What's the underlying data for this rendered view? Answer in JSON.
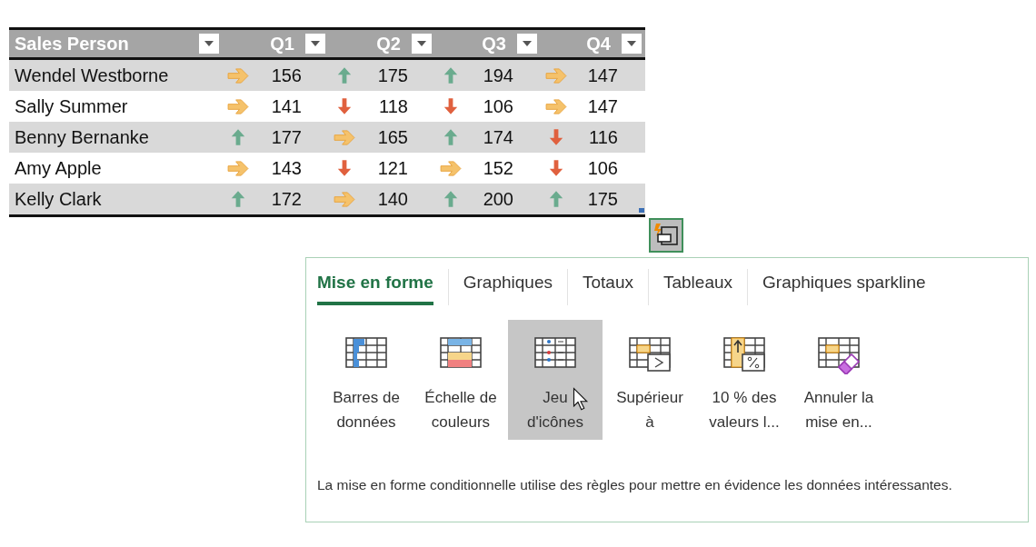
{
  "table": {
    "columns": [
      {
        "label": "Sales Person",
        "filter": true
      },
      {
        "label": "Q1",
        "filter": true
      },
      {
        "label": "Q2",
        "filter": true
      },
      {
        "label": "Q3",
        "filter": true
      },
      {
        "label": "Q4",
        "filter": true
      }
    ],
    "rows": [
      {
        "cells": [
          {
            "value": "Wendel Westborne"
          },
          {
            "value": "156",
            "kind": "flat"
          },
          {
            "value": "175",
            "kind": "up"
          },
          {
            "value": "194",
            "kind": "up"
          },
          {
            "value": "147",
            "kind": "flat"
          }
        ]
      },
      {
        "cells": [
          {
            "value": "Sally Summer"
          },
          {
            "value": "141",
            "kind": "flat"
          },
          {
            "value": "118",
            "kind": "down"
          },
          {
            "value": "106",
            "kind": "down"
          },
          {
            "value": "147",
            "kind": "flat"
          }
        ]
      },
      {
        "cells": [
          {
            "value": "Benny Bernanke"
          },
          {
            "value": "177",
            "kind": "up"
          },
          {
            "value": "165",
            "kind": "flat"
          },
          {
            "value": "174",
            "kind": "up"
          },
          {
            "value": "116",
            "kind": "down"
          }
        ]
      },
      {
        "cells": [
          {
            "value": "Amy Apple"
          },
          {
            "value": "143",
            "kind": "flat"
          },
          {
            "value": "121",
            "kind": "down"
          },
          {
            "value": "152",
            "kind": "flat"
          },
          {
            "value": "106",
            "kind": "down"
          }
        ]
      },
      {
        "cells": [
          {
            "value": "Kelly Clark"
          },
          {
            "value": "172",
            "kind": "up"
          },
          {
            "value": "140",
            "kind": "flat"
          },
          {
            "value": "200",
            "kind": "up"
          },
          {
            "value": "175",
            "kind": "up"
          }
        ]
      }
    ]
  },
  "quick_analysis": {
    "tabs": [
      {
        "label": "Mise en forme",
        "selected": true
      },
      {
        "label": "Graphiques",
        "selected": false
      },
      {
        "label": "Totaux",
        "selected": false
      },
      {
        "label": "Tableaux",
        "selected": false
      },
      {
        "label": "Graphiques sparkline",
        "selected": false
      }
    ],
    "options": [
      {
        "kind": "data_bars",
        "lines": [
          "Barres de",
          "données"
        ],
        "selected": false
      },
      {
        "kind": "color_scale",
        "lines": [
          "Échelle de",
          "couleurs"
        ],
        "selected": false
      },
      {
        "kind": "icon_set",
        "lines": [
          "Jeu",
          "d'icônes"
        ],
        "selected": true
      },
      {
        "kind": "greater_than",
        "lines": [
          "Supérieur",
          "à"
        ],
        "selected": false
      },
      {
        "kind": "top_10",
        "lines": [
          "10 % des",
          "valeurs l..."
        ],
        "selected": false
      },
      {
        "kind": "clear",
        "lines": [
          "Annuler la",
          "mise en..."
        ],
        "selected": false
      }
    ],
    "description": "La mise en forme conditionnelle utilise des règles pour mettre en évidence les données intéressantes."
  }
}
